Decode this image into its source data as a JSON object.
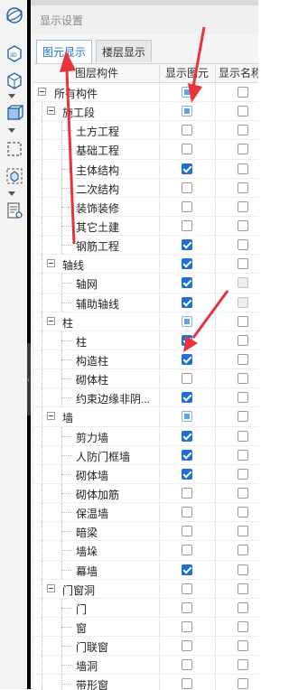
{
  "panel": {
    "title": "显示设置",
    "tabs": [
      {
        "label": "图元显示",
        "active": true
      },
      {
        "label": "楼层显示",
        "active": false
      }
    ]
  },
  "columns": [
    "图层构件",
    "显示图元",
    "显示名称"
  ],
  "toolbar": {
    "icons": [
      "orbit-icon",
      "3d-view-icon",
      "box-view-icon",
      "cube-view-icon",
      "select-region-icon",
      "component-select-icon",
      "list-view-icon"
    ]
  },
  "rows": [
    {
      "label": "所有构件",
      "level": 0,
      "expander": true,
      "show": "partial",
      "name": "unchecked"
    },
    {
      "label": "施工段",
      "level": 1,
      "expander": true,
      "show": "partial",
      "name": "unchecked"
    },
    {
      "label": "土方工程",
      "level": 2,
      "expander": false,
      "show": "unchecked",
      "name": "unchecked"
    },
    {
      "label": "基础工程",
      "level": 2,
      "expander": false,
      "show": "unchecked",
      "name": "unchecked"
    },
    {
      "label": "主体结构",
      "level": 2,
      "expander": false,
      "show": "checked",
      "name": "unchecked"
    },
    {
      "label": "二次结构",
      "level": 2,
      "expander": false,
      "show": "unchecked",
      "name": "unchecked"
    },
    {
      "label": "装饰装修",
      "level": 2,
      "expander": false,
      "show": "unchecked",
      "name": "unchecked"
    },
    {
      "label": "其它土建",
      "level": 2,
      "expander": false,
      "show": "unchecked",
      "name": "unchecked"
    },
    {
      "label": "钢筋工程",
      "level": 2,
      "expander": false,
      "show": "checked",
      "name": "unchecked"
    },
    {
      "label": "轴线",
      "level": 1,
      "expander": true,
      "show": "checked",
      "name": "unchecked"
    },
    {
      "label": "轴网",
      "level": 2,
      "expander": false,
      "show": "checked",
      "name": "disabled"
    },
    {
      "label": "辅助轴线",
      "level": 2,
      "expander": false,
      "show": "checked",
      "name": "disabled"
    },
    {
      "label": "柱",
      "level": 1,
      "expander": true,
      "show": "partial",
      "name": "unchecked"
    },
    {
      "label": "柱",
      "level": 2,
      "expander": false,
      "show": "checked",
      "name": "unchecked"
    },
    {
      "label": "构造柱",
      "level": 2,
      "expander": false,
      "show": "checked",
      "name": "unchecked"
    },
    {
      "label": "砌体柱",
      "level": 2,
      "expander": false,
      "show": "unchecked",
      "name": "unchecked"
    },
    {
      "label": "约束边缘非阴...",
      "level": 2,
      "expander": false,
      "show": "checked",
      "name": "unchecked"
    },
    {
      "label": "墙",
      "level": 1,
      "expander": true,
      "show": "partial",
      "name": "unchecked"
    },
    {
      "label": "剪力墙",
      "level": 2,
      "expander": false,
      "show": "checked",
      "name": "unchecked"
    },
    {
      "label": "人防门框墙",
      "level": 2,
      "expander": false,
      "show": "checked",
      "name": "unchecked"
    },
    {
      "label": "砌体墙",
      "level": 2,
      "expander": false,
      "show": "checked",
      "name": "unchecked"
    },
    {
      "label": "砌体加筋",
      "level": 2,
      "expander": false,
      "show": "unchecked",
      "name": "unchecked"
    },
    {
      "label": "保温墙",
      "level": 2,
      "expander": false,
      "show": "unchecked",
      "name": "unchecked"
    },
    {
      "label": "暗梁",
      "level": 2,
      "expander": false,
      "show": "unchecked",
      "name": "unchecked"
    },
    {
      "label": "墙垛",
      "level": 2,
      "expander": false,
      "show": "unchecked",
      "name": "unchecked"
    },
    {
      "label": "幕墙",
      "level": 2,
      "expander": false,
      "show": "checked",
      "name": "unchecked"
    },
    {
      "label": "门窗洞",
      "level": 1,
      "expander": true,
      "show": "unchecked",
      "name": "unchecked"
    },
    {
      "label": "门",
      "level": 2,
      "expander": false,
      "show": "unchecked",
      "name": "unchecked"
    },
    {
      "label": "窗",
      "level": 2,
      "expander": false,
      "show": "unchecked",
      "name": "unchecked"
    },
    {
      "label": "门联窗",
      "level": 2,
      "expander": false,
      "show": "unchecked",
      "name": "unchecked"
    },
    {
      "label": "墙洞",
      "level": 2,
      "expander": false,
      "show": "unchecked",
      "name": "unchecked"
    },
    {
      "label": "带形窗",
      "level": 2,
      "expander": false,
      "show": "unchecked",
      "name": "unchecked"
    }
  ],
  "colors": {
    "accent": "#1e6fd6",
    "annotation": "#e8333a"
  }
}
